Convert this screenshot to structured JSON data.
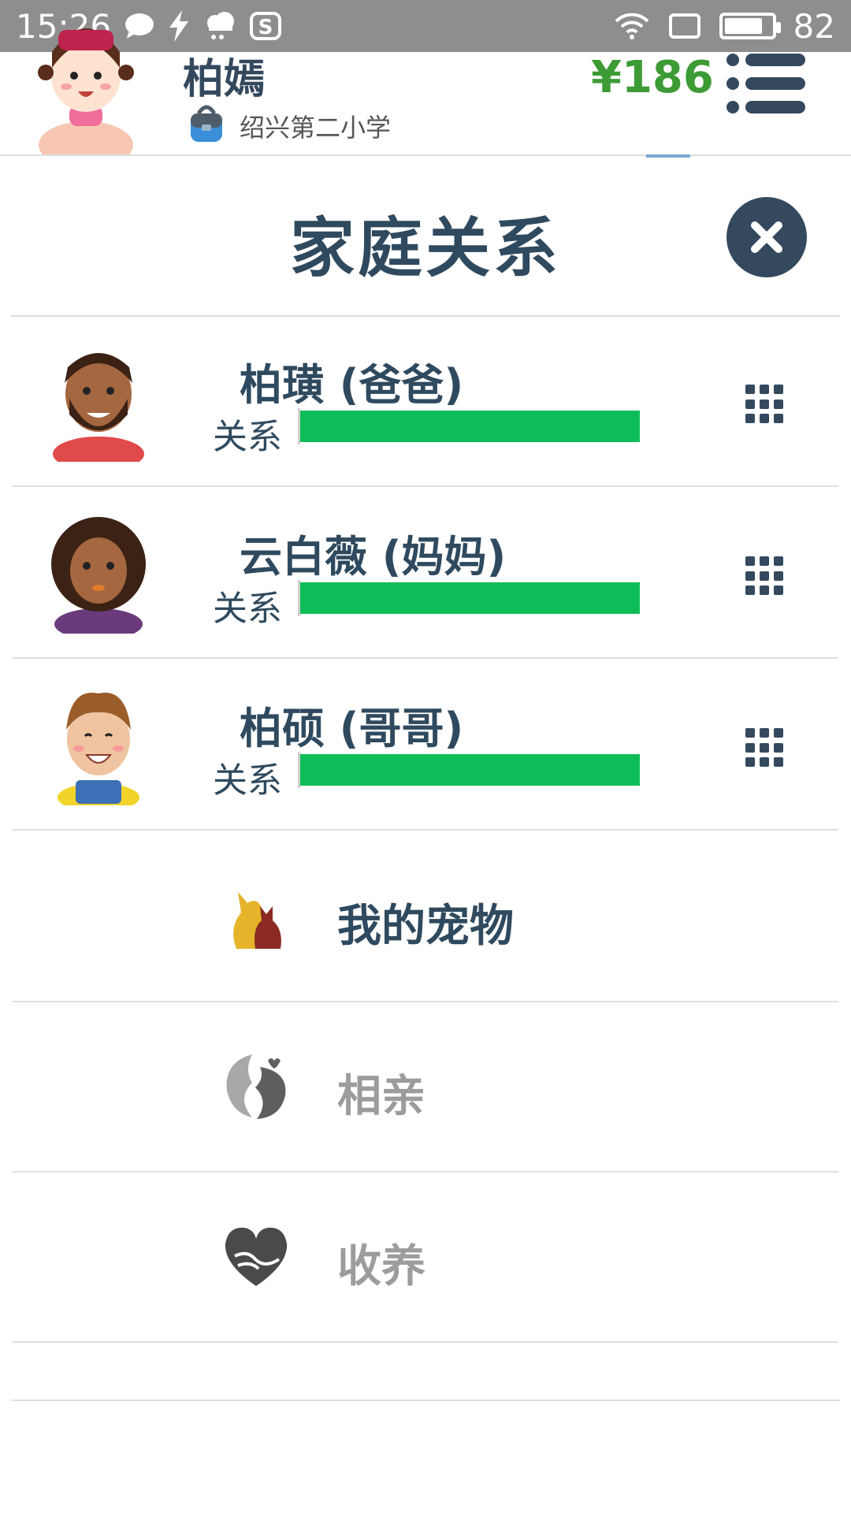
{
  "status_bar": {
    "time": "15:26",
    "battery": "82",
    "battery_level": 0.82,
    "icons_left": [
      "chat-bubble-icon",
      "lightning-icon",
      "cloud-icon",
      "s-app-icon"
    ],
    "icons_right": [
      "wifi-icon",
      "screen-rotate-icon",
      "battery-icon"
    ]
  },
  "profile": {
    "name": "柏嫣",
    "school": "绍兴第二小学",
    "money": "¥186"
  },
  "modal": {
    "title": "家庭关系"
  },
  "family": [
    {
      "name": "柏璜 (爸爸)",
      "relation_label": "关系",
      "relation_level": 1.0,
      "avatar": "father-avatar"
    },
    {
      "name": "云白薇 (妈妈)",
      "relation_label": "关系",
      "relation_level": 1.0,
      "avatar": "mother-avatar"
    },
    {
      "name": "柏硕 (哥哥)",
      "relation_label": "关系",
      "relation_level": 1.0,
      "avatar": "brother-avatar"
    }
  ],
  "menu": [
    {
      "label": "我的宠物",
      "icon": "pet-icon",
      "enabled": true
    },
    {
      "label": "相亲",
      "icon": "matchmaking-icon",
      "enabled": false
    },
    {
      "label": "收养",
      "icon": "adopt-heart-icon",
      "enabled": false
    }
  ],
  "colors": {
    "status_bar": "#8e8e8e",
    "title_text": "#2f4a5f",
    "money": "#3d9b35",
    "relation_bar": "#0fbd58",
    "disabled_text": "#9c9c9c",
    "divider": "#dcdfe3"
  }
}
